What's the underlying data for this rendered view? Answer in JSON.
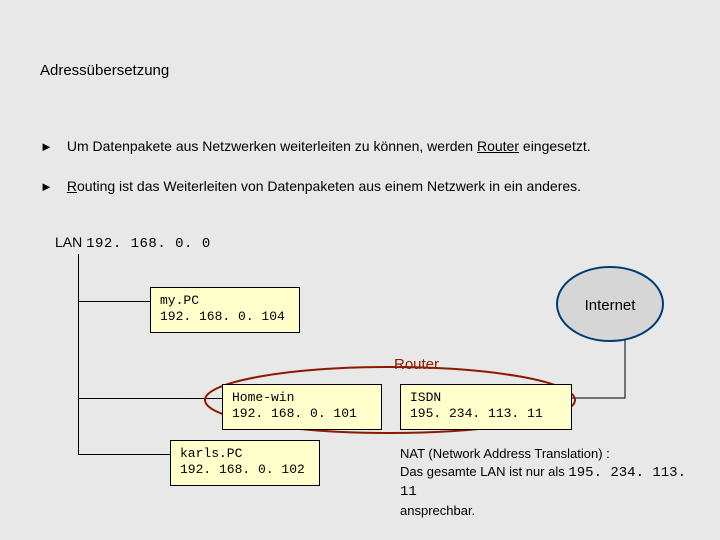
{
  "title": "Adressübersetzung",
  "bullets": [
    {
      "pre": "Um Datenpakete aus Netzwerken weiterleiten zu können, werden ",
      "u": "Router",
      "post": " eingesetzt."
    },
    {
      "pre": "",
      "u": "R",
      "post": "outing ist das Weiterleiten von Datenpaketen aus einem Netzwerk in ein anderes."
    }
  ],
  "lan": {
    "label": "LAN ",
    "ip": "192. 168. 0. 0"
  },
  "nodes": {
    "mypc": {
      "name": "my.PC",
      "ip": "192. 168. 0. 104"
    },
    "homewin": {
      "name": "Home-win",
      "ip": "192. 168. 0. 101"
    },
    "isdn": {
      "name": "ISDN",
      "ip": "195. 234. 113. 11"
    },
    "karlspc": {
      "name": "karls.PC",
      "ip": "192. 168. 0. 102"
    }
  },
  "router_label": "Router",
  "internet_label": "Internet",
  "nat": {
    "line1": "NAT (Network Address Translation) :",
    "line2a": "Das gesamte LAN ist nur als ",
    "line2ip": "195. 234. 113. 11",
    "line3": "ansprechbar."
  },
  "colors": {
    "box_fill": "#ffffcc",
    "router_stroke": "#8b1a00",
    "internet_stroke": "#003b73",
    "internet_fill": "#d0d0d0"
  }
}
